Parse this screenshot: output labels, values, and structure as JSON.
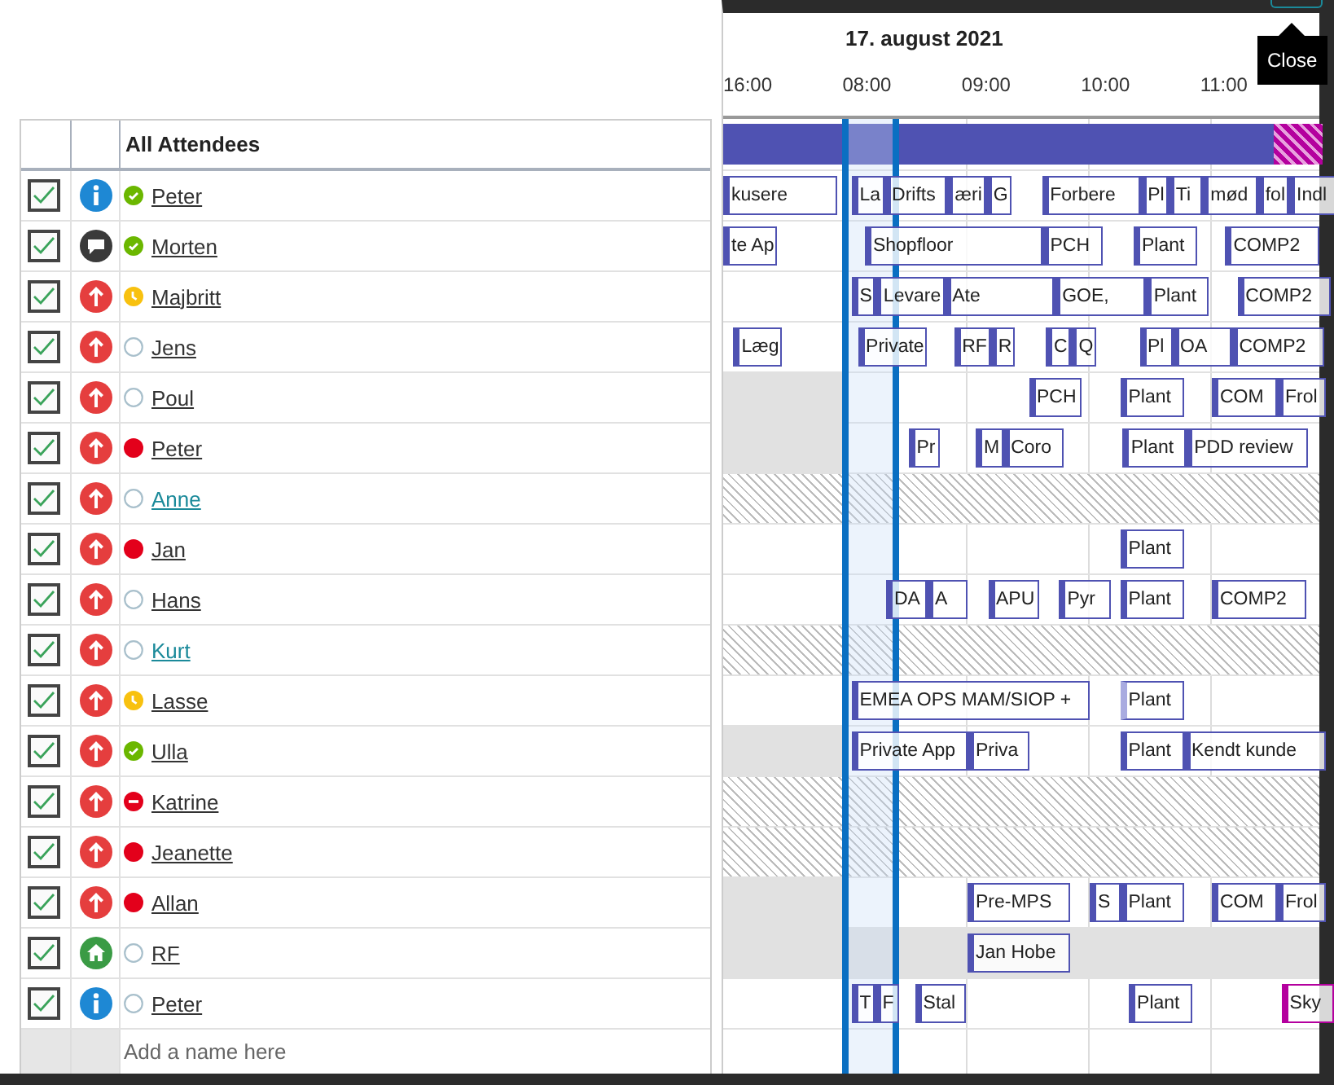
{
  "header": {
    "date": "17. august 2021",
    "times": [
      "16:00",
      "08:00",
      "09:00",
      "10:00",
      "11:00"
    ]
  },
  "tooltip": {
    "text": "Close"
  },
  "table": {
    "title": "All Attendees",
    "add_placeholder": "Add a name here"
  },
  "summary": [
    {
      "kind": "busy"
    },
    {
      "kind": "oof"
    }
  ],
  "attendees": [
    {
      "name": "Peter",
      "checked": true,
      "role": {
        "kind": "info"
      },
      "presence": {
        "kind": "available"
      },
      "color": "#333333",
      "availability": {
        "kind": "plain"
      },
      "events": [
        {
          "title": "kusere",
          "kind": "busy"
        },
        {
          "title": "La",
          "kind": "busy"
        },
        {
          "title": "Drifts",
          "kind": "busy"
        },
        {
          "title": "æri",
          "kind": "busy"
        },
        {
          "title": "G",
          "kind": "busy"
        },
        {
          "title": "Forbere",
          "kind": "busy"
        },
        {
          "title": "Pl",
          "kind": "busy"
        },
        {
          "title": "Ti",
          "kind": "busy"
        },
        {
          "title": "mød",
          "kind": "busy"
        },
        {
          "title": "fol",
          "kind": "busy"
        },
        {
          "title": "Indl",
          "kind": "busy"
        }
      ]
    },
    {
      "name": "Morten",
      "checked": true,
      "role": {
        "kind": "chat"
      },
      "presence": {
        "kind": "available"
      },
      "color": "#333333",
      "availability": {
        "kind": "plain"
      },
      "events": [
        {
          "title": "te Ap",
          "kind": "busy"
        },
        {
          "title": "Shopfloor",
          "kind": "busy"
        },
        {
          "title": "PCH",
          "kind": "busy"
        },
        {
          "title": "Plant",
          "kind": "busy"
        },
        {
          "title": "COMP2",
          "kind": "busy"
        }
      ]
    },
    {
      "name": "Majbritt",
      "checked": true,
      "role": {
        "kind": "required"
      },
      "presence": {
        "kind": "away"
      },
      "color": "#333333",
      "availability": {
        "kind": "plain"
      },
      "events": [
        {
          "title": "S",
          "kind": "busy"
        },
        {
          "title": "Levare",
          "kind": "busy"
        },
        {
          "title": "Ate",
          "kind": "busy"
        },
        {
          "title": "GOE,",
          "kind": "busy"
        },
        {
          "title": "Plant",
          "kind": "busy"
        },
        {
          "title": "COMP2",
          "kind": "busy"
        }
      ]
    },
    {
      "name": "Jens",
      "checked": true,
      "role": {
        "kind": "required"
      },
      "presence": {
        "kind": "offline"
      },
      "color": "#333333",
      "availability": {
        "kind": "plain"
      },
      "events": [
        {
          "title": "Læg",
          "kind": "busy"
        },
        {
          "title": "Private",
          "kind": "busy"
        },
        {
          "title": "RF",
          "kind": "busy"
        },
        {
          "title": "R",
          "kind": "busy"
        },
        {
          "title": "C",
          "kind": "busy"
        },
        {
          "title": "Q",
          "kind": "busy"
        },
        {
          "title": "Pl",
          "kind": "busy"
        },
        {
          "title": "OA",
          "kind": "busy"
        },
        {
          "title": "COMP2",
          "kind": "busy"
        }
      ]
    },
    {
      "name": "Poul",
      "checked": true,
      "role": {
        "kind": "required"
      },
      "presence": {
        "kind": "offline"
      },
      "color": "#333333",
      "availability": {
        "kind": "grey-left"
      },
      "events": [
        {
          "title": "PCH",
          "kind": "busy"
        },
        {
          "title": "Plant",
          "kind": "busy"
        },
        {
          "title": "COM",
          "kind": "busy"
        },
        {
          "title": "Frol",
          "kind": "busy"
        }
      ]
    },
    {
      "name": "Peter",
      "checked": true,
      "role": {
        "kind": "required"
      },
      "presence": {
        "kind": "busy"
      },
      "color": "#333333",
      "availability": {
        "kind": "grey-left"
      },
      "events": [
        {
          "title": "Pr",
          "kind": "busy"
        },
        {
          "title": "M",
          "kind": "busy"
        },
        {
          "title": "Coro",
          "kind": "busy"
        },
        {
          "title": "Plant",
          "kind": "busy"
        },
        {
          "title": "PDD review",
          "kind": "busy"
        }
      ]
    },
    {
      "name": "Anne",
      "checked": true,
      "role": {
        "kind": "required"
      },
      "presence": {
        "kind": "offline"
      },
      "color": "#1b8a9a",
      "availability": {
        "kind": "hatched"
      }
    },
    {
      "name": "Jan",
      "checked": true,
      "role": {
        "kind": "required"
      },
      "presence": {
        "kind": "busy"
      },
      "color": "#333333",
      "availability": {
        "kind": "plain"
      },
      "events": [
        {
          "title": "Plant",
          "kind": "busy"
        }
      ]
    },
    {
      "name": "Hans",
      "checked": true,
      "role": {
        "kind": "required"
      },
      "presence": {
        "kind": "offline"
      },
      "color": "#333333",
      "availability": {
        "kind": "plain"
      },
      "events": [
        {
          "title": "DA",
          "kind": "busy"
        },
        {
          "title": "A",
          "kind": "busy"
        },
        {
          "title": "APU",
          "kind": "busy"
        },
        {
          "title": "Pyr",
          "kind": "busy"
        },
        {
          "title": "Plant",
          "kind": "busy"
        },
        {
          "title": "COMP2",
          "kind": "busy"
        }
      ]
    },
    {
      "name": "Kurt",
      "checked": true,
      "role": {
        "kind": "required"
      },
      "presence": {
        "kind": "offline"
      },
      "color": "#1b8a9a",
      "availability": {
        "kind": "hatched"
      }
    },
    {
      "name": "Lasse",
      "checked": true,
      "role": {
        "kind": "required"
      },
      "presence": {
        "kind": "away"
      },
      "color": "#333333",
      "availability": {
        "kind": "plain"
      },
      "events": [
        {
          "title": "EMEA OPS MAM/SIOP +",
          "kind": "busy"
        },
        {
          "title": "Plant",
          "kind": "tentative"
        }
      ]
    },
    {
      "name": "Ulla",
      "checked": true,
      "role": {
        "kind": "required"
      },
      "presence": {
        "kind": "available"
      },
      "color": "#333333",
      "availability": {
        "kind": "grey-left"
      },
      "events": [
        {
          "title": "Private App",
          "kind": "busy"
        },
        {
          "title": "Priva",
          "kind": "busy"
        },
        {
          "title": "Plant",
          "kind": "busy"
        },
        {
          "title": "Kendt kunde",
          "kind": "busy"
        }
      ]
    },
    {
      "name": "Katrine",
      "checked": true,
      "role": {
        "kind": "required"
      },
      "presence": {
        "kind": "dnd"
      },
      "color": "#333333",
      "availability": {
        "kind": "hatched"
      }
    },
    {
      "name": "Jeanette",
      "checked": true,
      "role": {
        "kind": "required"
      },
      "presence": {
        "kind": "busy"
      },
      "color": "#333333",
      "availability": {
        "kind": "hatched"
      }
    },
    {
      "name": "Allan",
      "checked": true,
      "role": {
        "kind": "required"
      },
      "presence": {
        "kind": "busy"
      },
      "color": "#333333",
      "availability": {
        "kind": "grey-left"
      },
      "events": [
        {
          "title": "Pre-MPS",
          "kind": "busy"
        },
        {
          "title": "S",
          "kind": "busy"
        },
        {
          "title": "Plant",
          "kind": "busy"
        },
        {
          "title": "COM",
          "kind": "busy"
        },
        {
          "title": "Frol",
          "kind": "busy"
        }
      ]
    },
    {
      "name": "RF",
      "checked": true,
      "role": {
        "kind": "home"
      },
      "presence": {
        "kind": "offline"
      },
      "color": "#333333",
      "availability": {
        "kind": "grey"
      },
      "events": [
        {
          "title": "Jan Hobe",
          "kind": "busy"
        }
      ]
    },
    {
      "name": "Peter",
      "checked": true,
      "role": {
        "kind": "info"
      },
      "presence": {
        "kind": "offline"
      },
      "color": "#333333",
      "availability": {
        "kind": "plain"
      },
      "events": [
        {
          "title": "T",
          "kind": "busy"
        },
        {
          "title": "F",
          "kind": "busy"
        },
        {
          "title": "Stal",
          "kind": "busy"
        },
        {
          "title": "Plant",
          "kind": "busy"
        },
        {
          "title": "Sky",
          "kind": "oof"
        }
      ]
    }
  ]
}
